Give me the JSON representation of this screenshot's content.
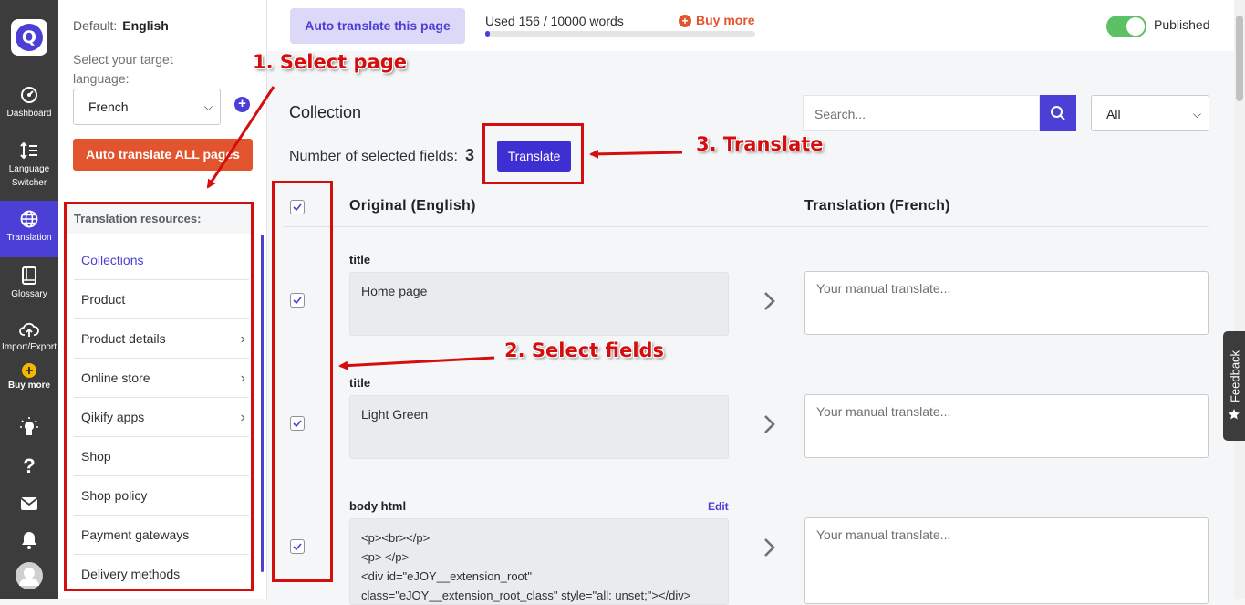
{
  "nav": {
    "logo": "Q",
    "items": [
      "Dashboard",
      "Language Switcher",
      "Translation",
      "Glossary",
      "Import/Export",
      "Buy more"
    ]
  },
  "sidebar": {
    "default_label": "Default:",
    "default_value": "English",
    "target_label": "Select your target language:",
    "target_value": "French",
    "auto_all": "Auto translate ALL pages",
    "resources_title": "Translation resources:",
    "resources": [
      "Collections",
      "Product",
      "Product details",
      "Online store",
      "Qikify apps",
      "Shop",
      "Shop policy",
      "Payment gateways",
      "Delivery methods"
    ]
  },
  "topbar": {
    "auto_page": "Auto translate this page",
    "usage": "Used 156 / 10000 words",
    "usage_fraction": 0.0156,
    "buy_more": "Buy more",
    "published": "Published",
    "published_on": true
  },
  "main": {
    "title": "Collection",
    "search_placeholder": "Search...",
    "filter": "All",
    "selected_label": "Number of selected fields:",
    "selected_count": "3",
    "translate_btn": "Translate",
    "header_original": "Original (English)",
    "header_translation": "Translation (French)",
    "edit": "Edit",
    "fields": [
      {
        "label": "title",
        "original": "Home page",
        "placeholder": "Your manual translate..."
      },
      {
        "label": "title",
        "original": "Light Green",
        "placeholder": "Your manual translate..."
      },
      {
        "label": "body html",
        "original_lines": [
          "<p><br></p>",
          "<p> </p>",
          "<div id=\"eJOY__extension_root\"",
          "class=\"eJOY__extension_root_class\" style=\"all: unset;\"></div>"
        ],
        "placeholder": "Your manual translate..."
      }
    ]
  },
  "feedback": "Feedback",
  "annotations": [
    "1. Select page",
    "2. Select fields",
    "3. Translate"
  ],
  "colors": {
    "accent": "#4b3fd6",
    "orange": "#e2542d",
    "annotation": "#d40e0e",
    "nav_bg": "#3c3c3c"
  }
}
